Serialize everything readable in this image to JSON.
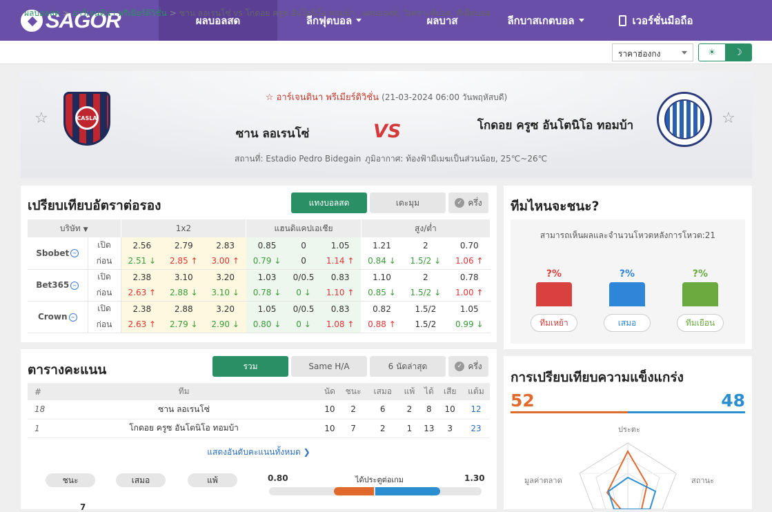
{
  "nav": {
    "logo": "SAGOR",
    "items": [
      "ผลบอลสด",
      "ลีกฟุตบอล",
      "ผลบาส",
      "ลีกบาสเกตบอล",
      "เวอร์ชั่นมือถือ"
    ]
  },
  "breadcrumb": {
    "home": "ผลบอลสด",
    "league": "อาร์เจนตินา พรีเมียร์ดิวิชั่น",
    "current": "ซาน ลอเรนโซ่ vs โกดอย ครูซ อันโตนิโอ ทอมบ้า ,  ผลบอลสด,  วิเคราะห์บอล,  ทีเด็ดบอล"
  },
  "odds_format": "ราคาฮ่องกง",
  "theme_toggle": {
    "light": "☀",
    "dark": "☽"
  },
  "match": {
    "league": "อาร์เจนตินา พรีเมียร์ดิวิชั่น",
    "datetime": "(21-03-2024 06:00 วันพฤหัสบดี)",
    "home": "ซาน ลอเรนโซ่",
    "away": "โกดอย ครูซ อันโตนิโอ ทอมบ้า",
    "vs": "VS",
    "venue": "สถานที่: Estadio Pedro Bidegain",
    "weather": "ภูมิอากาศ: ท้องฟ้ามีเมฆเป็นส่วนน้อย, 25℃~26℃",
    "home_badge": "CASLA"
  },
  "odds": {
    "title": "เปรียบเทียบอัตราต่อรอง",
    "tabs": [
      "แทงบอลสด",
      "เดะมุม",
      "ครึ่ง"
    ],
    "headers": [
      "บริษัท",
      "1x2",
      "แฮนดิแคปเอเชีย",
      "สูง/ต่ำ"
    ],
    "open_label": "เปิด",
    "before_label": "ก่อน",
    "companies": [
      {
        "name": "Sbobet",
        "open": [
          "2.56",
          "2.79",
          "2.83",
          "0.85",
          "0",
          "1.05",
          "1.21",
          "2",
          "0.70"
        ],
        "before": [
          [
            "2.51",
            "dn"
          ],
          [
            "2.85",
            "up"
          ],
          [
            "3.00",
            "up"
          ],
          [
            "0.79",
            "dn"
          ],
          [
            "0",
            ""
          ],
          [
            "1.14",
            "up"
          ],
          [
            "0.84",
            "dn"
          ],
          [
            "1.5/2",
            "dn"
          ],
          [
            "1.06",
            "up"
          ]
        ]
      },
      {
        "name": "Bet365",
        "open": [
          "2.38",
          "3.10",
          "3.20",
          "1.03",
          "0/0.5",
          "0.83",
          "1.10",
          "2",
          "0.78"
        ],
        "before": [
          [
            "2.63",
            "up"
          ],
          [
            "2.88",
            "dn"
          ],
          [
            "3.10",
            "dn"
          ],
          [
            "0.78",
            "dn"
          ],
          [
            "0",
            "dn"
          ],
          [
            "1.10",
            "up"
          ],
          [
            "0.85",
            "dn"
          ],
          [
            "1.5/2",
            "dn"
          ],
          [
            "1.00",
            "up"
          ]
        ]
      },
      {
        "name": "Crown",
        "open": [
          "2.38",
          "2.88",
          "3.20",
          "1.05",
          "0/0.5",
          "0.83",
          "0.82",
          "1.5/2",
          "1.05"
        ],
        "before": [
          [
            "2.63",
            "up"
          ],
          [
            "2.79",
            "dn"
          ],
          [
            "2.90",
            "dn"
          ],
          [
            "0.80",
            "dn"
          ],
          [
            "0",
            "dn"
          ],
          [
            "1.08",
            "up"
          ],
          [
            "0.88",
            "up"
          ],
          [
            "1.5/2",
            ""
          ],
          [
            "0.99",
            "dn"
          ]
        ]
      }
    ]
  },
  "standings": {
    "title": "ตารางคะแนน",
    "tabs": [
      "รวม",
      "Same H/A",
      "6 นัดล่าสุด",
      "ครึ่ง"
    ],
    "headers": [
      "#",
      "ทีม",
      "นัด",
      "ชนะ",
      "เสมอ",
      "แพ้",
      "ได้",
      "เสีย",
      "แต้ม"
    ],
    "rows": [
      [
        "18",
        "ซาน ลอเรนโซ่",
        "10",
        "2",
        "6",
        "2",
        "8",
        "10",
        "12"
      ],
      [
        "1",
        "โกดอย ครูซ อันโตนิโอ ทอมบ้า",
        "10",
        "7",
        "2",
        "1",
        "13",
        "3",
        "23"
      ]
    ],
    "show_all": "แสดงอันดับคะแนนทั้งหมด ❯"
  },
  "stats": {
    "pills": [
      "ชนะ",
      "เสมอ",
      "แพ้"
    ],
    "goals_left": "0.80",
    "goals_label": "ได้ประตูต่อเกม",
    "goals_right": "1.30",
    "peek_value": "7"
  },
  "prediction": {
    "title": "ทีมไหนจะชนะ?",
    "note": "สามารถเห็นผลและจำนวนโหวตหลังการโหวต:21",
    "options": [
      {
        "pct": "?%",
        "label": "ทีมเหย้า",
        "color": "#d94040"
      },
      {
        "pct": "?%",
        "label": "เสมอ",
        "color": "#2f86d9"
      },
      {
        "pct": "?%",
        "label": "ทีมเยือน",
        "color": "#6aaa3e"
      }
    ]
  },
  "strength": {
    "title": "การเปรียบเทียบความแข็งแกร่ง",
    "home": "52",
    "away": "48",
    "labels": [
      "ประตะ",
      "สถานะ",
      "มูลค่าตลาด"
    ]
  }
}
